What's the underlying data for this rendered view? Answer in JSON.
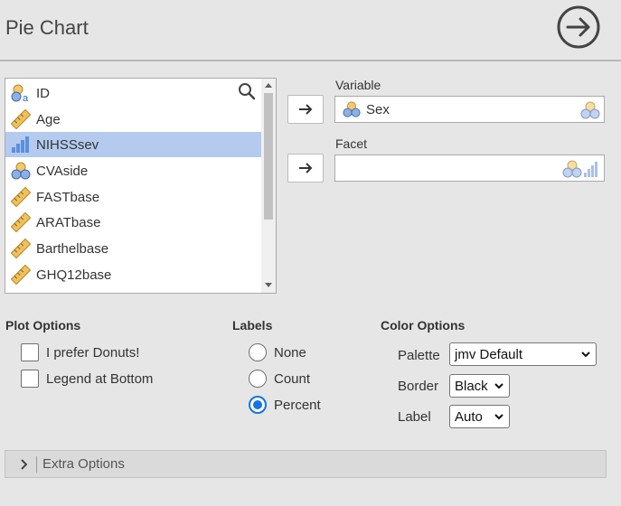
{
  "header": {
    "title": "Pie Chart"
  },
  "variables": [
    {
      "label": "ID",
      "icon": "nominal-text-icon",
      "selected": false
    },
    {
      "label": "Age",
      "icon": "continuous-ruler-icon",
      "selected": false
    },
    {
      "label": "NIHSSsev",
      "icon": "ordinal-bars-icon",
      "selected": true
    },
    {
      "label": "CVAside",
      "icon": "nominal-circles-icon",
      "selected": false
    },
    {
      "label": "FASTbase",
      "icon": "continuous-ruler-icon",
      "selected": false
    },
    {
      "label": "ARATbase",
      "icon": "continuous-ruler-icon",
      "selected": false
    },
    {
      "label": "Barthelbase",
      "icon": "continuous-ruler-icon",
      "selected": false
    },
    {
      "label": "GHQ12base",
      "icon": "continuous-ruler-icon",
      "selected": false
    }
  ],
  "targets": {
    "variable": {
      "label": "Variable",
      "value": "Sex"
    },
    "facet": {
      "label": "Facet",
      "value": ""
    }
  },
  "plot_options": {
    "title": "Plot Options",
    "donut_label": "I prefer Donuts!",
    "donut_checked": false,
    "legend_label": "Legend at Bottom",
    "legend_checked": false
  },
  "labels": {
    "title": "Labels",
    "options": [
      "None",
      "Count",
      "Percent"
    ],
    "selected": "Percent"
  },
  "color_options": {
    "title": "Color Options",
    "palette_label": "Palette",
    "palette_value": "jmv Default",
    "border_label": "Border",
    "border_value": "Black",
    "label_label": "Label",
    "label_value": "Auto"
  },
  "extra_options": {
    "label": "Extra Options"
  },
  "colors": {
    "accent": "#1473e6",
    "selected_row": "#b4cbef"
  }
}
